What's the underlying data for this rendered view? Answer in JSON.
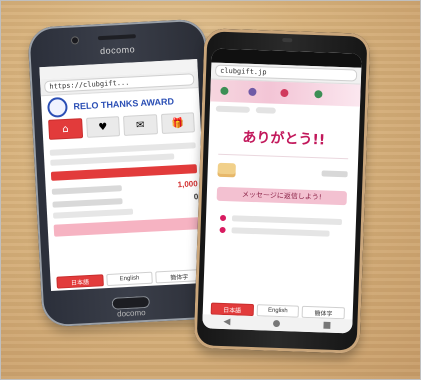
{
  "scene": {
    "phone_left": {
      "brand_top": "docomo",
      "brand_bottom": "docomo",
      "url": "https://clubgift...",
      "site_title": "RELO THANKS AWARD",
      "values": [
        "1,000",
        "0"
      ],
      "footer_buttons": [
        "日本語",
        "English",
        "簡体字"
      ]
    },
    "phone_right": {
      "url": "clubgift.jp",
      "thanks_title": "ありがとう!!",
      "message_button": "メッセージに返信しよう!",
      "footer_buttons": [
        "日本語",
        "English",
        "簡体字"
      ],
      "nav_icons": [
        "◀",
        "●",
        "■"
      ]
    }
  },
  "colors": {
    "accent_red": "#e23b3b",
    "accent_pink": "#f3c1d1",
    "title_pink": "#c2185b",
    "brand_blue": "#2b4fb5"
  }
}
